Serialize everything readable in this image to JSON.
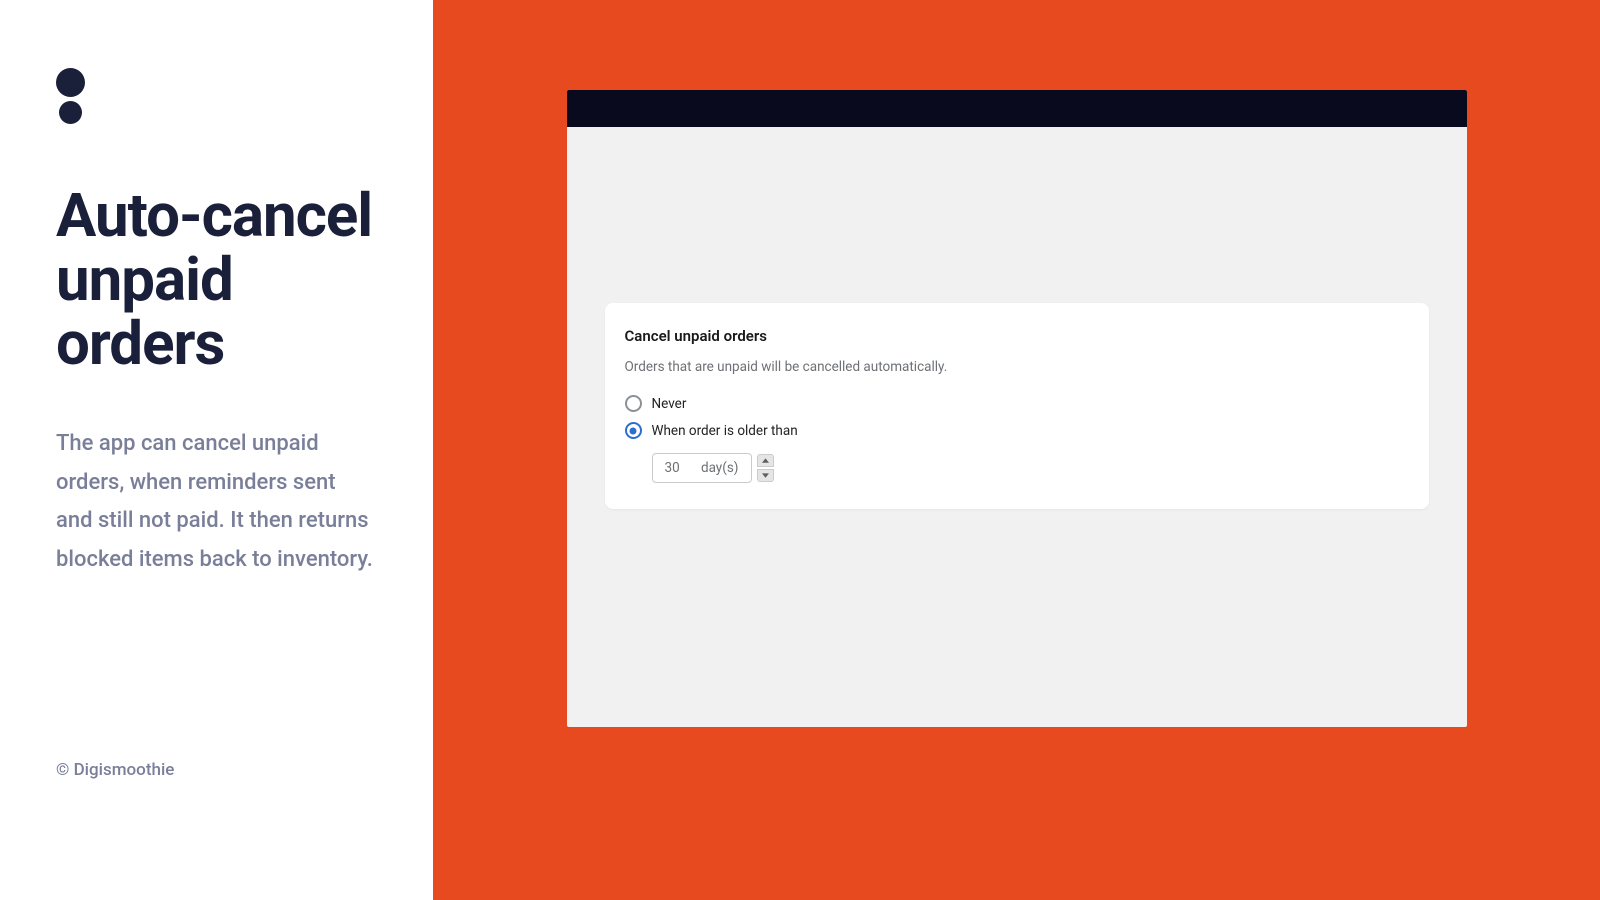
{
  "left": {
    "headline": "Auto-cancel unpaid orders",
    "description": "The app can cancel unpaid orders, when reminders sent and still not paid. It then returns blocked items back to inventory.",
    "copyright": "© Digismoothie"
  },
  "settings": {
    "card_title": "Cancel unpaid orders",
    "card_description": "Orders that are unpaid will be cancelled automatically.",
    "options": {
      "never": "Never",
      "older_than": "When order is older than"
    },
    "number_value": "30",
    "unit": "day(s)"
  }
}
